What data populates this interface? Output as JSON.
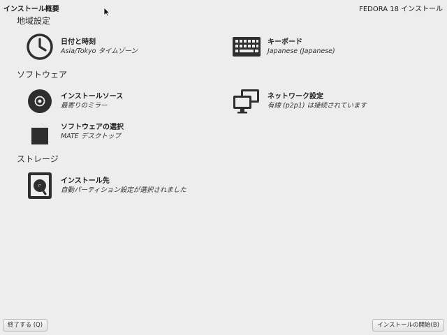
{
  "header": {
    "title": "インストール概要",
    "product": "FEDORA 18 インストール"
  },
  "sections": [
    {
      "label": "地域設定"
    },
    {
      "label": "ソフトウェア"
    },
    {
      "label": "ストレージ"
    }
  ],
  "spokes": {
    "datetime": {
      "title": "日付と時刻",
      "status": "Asia/Tokyo タイムゾーン",
      "icon": "clock-icon"
    },
    "keyboard": {
      "title": "キーボード",
      "status": "Japanese (Japanese)",
      "icon": "keyboard-icon"
    },
    "source": {
      "title": "インストールソース",
      "status": "最寄りのミラー",
      "icon": "disc-icon"
    },
    "network": {
      "title": "ネットワーク設定",
      "status": "有線 (p2p1) は接続されています",
      "icon": "network-icon"
    },
    "software": {
      "title": "ソフトウェアの選択",
      "status": "MATE デスクトップ",
      "icon": "package-icon"
    },
    "destination": {
      "title": "インストール先",
      "status": "自動パーティション設定が選択されました",
      "icon": "harddisk-icon"
    }
  },
  "buttons": {
    "quit": "終了する (Q)",
    "begin": "インストールの開始(B)"
  },
  "colors": {
    "background": "#ededed",
    "icon": "#2e2e2e"
  }
}
